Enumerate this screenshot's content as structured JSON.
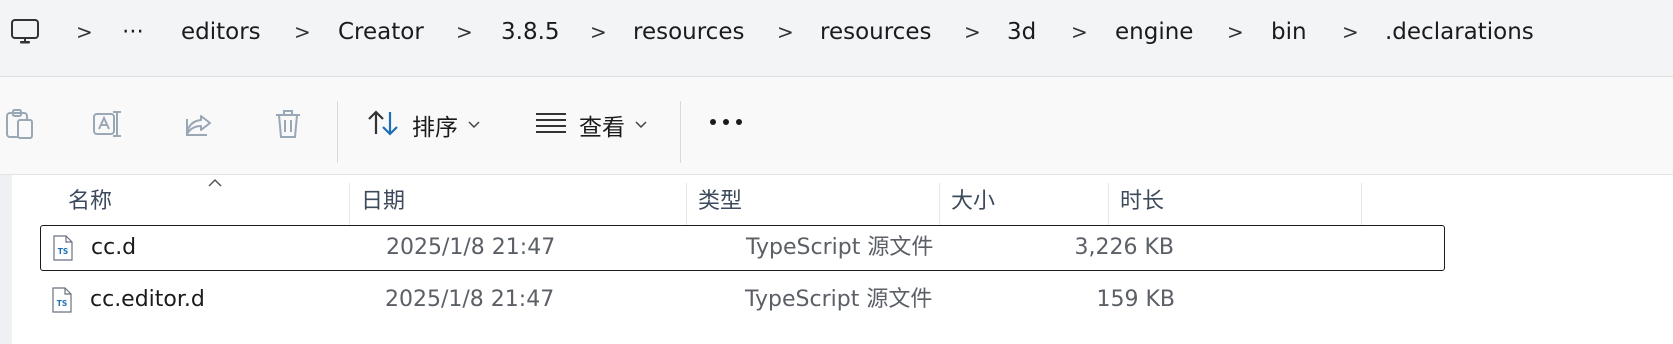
{
  "breadcrumb": {
    "more": "⋯",
    "separator": ">",
    "items": [
      "editors",
      "Creator",
      "3.8.5",
      "resources",
      "resources",
      "3d",
      "engine",
      "bin",
      ".declarations"
    ]
  },
  "toolbar": {
    "sort_label": "排序",
    "view_label": "查看",
    "more": "•••"
  },
  "columns": [
    "名称",
    "日期",
    "类型",
    "大小",
    "时长"
  ],
  "files": [
    {
      "icon": "TS",
      "name": "cc.d",
      "date": "2025/1/8 21:47",
      "type": "TypeScript 源文件",
      "size": "3,226 KB",
      "selected": true
    },
    {
      "icon": "TS",
      "name": "cc.editor.d",
      "date": "2025/1/8 21:47",
      "type": "TypeScript 源文件",
      "size": "159 KB",
      "selected": false
    }
  ],
  "colors": {
    "accent": "#1f6fb8",
    "disabled_icon": "#9aa7b4"
  }
}
